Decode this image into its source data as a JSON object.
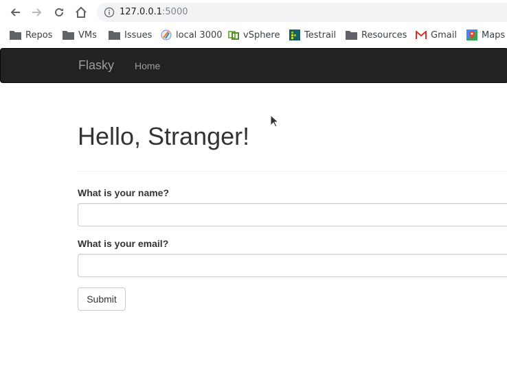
{
  "browser": {
    "url_host": "127.0.0.1",
    "url_port": ":5000",
    "bookmarks": [
      {
        "label": "Repos",
        "icon": "folder-icon"
      },
      {
        "label": "VMs",
        "icon": "folder-icon"
      },
      {
        "label": "Issues",
        "icon": "folder-icon"
      },
      {
        "label": "local 3000",
        "icon": "site-icon"
      },
      {
        "label": "vSphere",
        "icon": "vsphere-icon"
      },
      {
        "label": "Testrail",
        "icon": "testrail-icon"
      },
      {
        "label": "Resources",
        "icon": "folder-icon"
      },
      {
        "label": "Gmail",
        "icon": "gmail-icon"
      },
      {
        "label": "Maps",
        "icon": "maps-icon"
      }
    ]
  },
  "navbar": {
    "brand": "Flasky",
    "home_link": "Home"
  },
  "main": {
    "heading": "Hello, Stranger!",
    "form": {
      "name_label": "What is your name?",
      "name_value": "",
      "email_label": "What is your email?",
      "email_value": "",
      "submit_label": "Submit"
    }
  },
  "colors": {
    "navbar_bg": "#222222",
    "navbar_text": "#9d9d9d",
    "heading_text": "#333333"
  }
}
